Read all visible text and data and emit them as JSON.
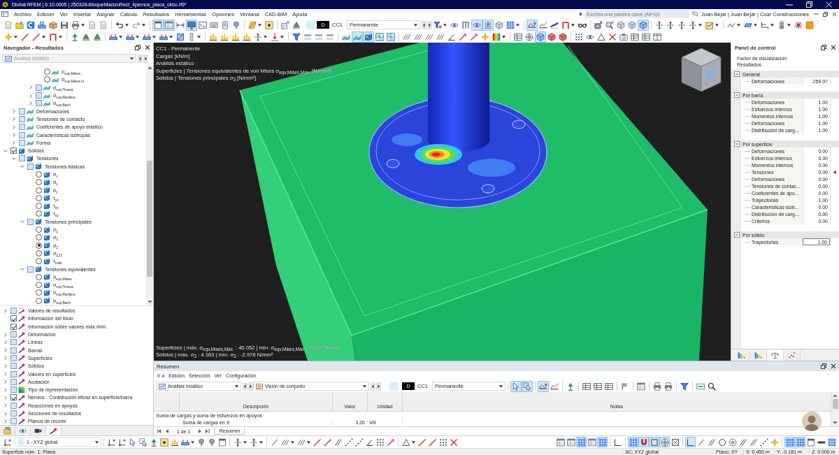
{
  "window": {
    "title": "Dlubal RFEM | 6.10.0005 | 250328-BloqueMacizoRect_4pernos_placa_circu.rf6*"
  },
  "menu": {
    "items": [
      "Archivo",
      "Edición",
      "Ver",
      "Insertar",
      "Asignar",
      "Cálculo",
      "Resultados",
      "Herramientas",
      "Opciones",
      "Ventana",
      "CAD-BIM",
      "Ayuda"
    ],
    "search": {
      "placeholder": "Escriba una palabra clave (Alt+Q)"
    },
    "user": "Juan Bejar | Juan Bejár | Coar Construcciones"
  },
  "toolbar_1": {
    "buttons": [
      {
        "pressed": false
      },
      {
        "pressed": false
      },
      {
        "pressed": false
      },
      {
        "pressed": false
      },
      {
        "pressed": false
      },
      {
        "pressed": false
      },
      {
        "pressed": false
      },
      {
        "pressed": false
      },
      {
        "pressed": false
      },
      {
        "pressed": false
      },
      {
        "pressed": false
      },
      {
        "pressed": true
      },
      {
        "pressed": true
      },
      {
        "pressed": false
      },
      {
        "pressed": true
      },
      {
        "pressed": false
      },
      {
        "pressed": false
      },
      {
        "pressed": false
      },
      {
        "pressed": false
      },
      {
        "pressed": false
      },
      {
        "pressed": false
      },
      {
        "pressed": false
      },
      {
        "pressed": false
      }
    ],
    "load_case": {
      "type": "D",
      "number": "CC1",
      "name": "Permanente"
    },
    "buttons_after": [
      {
        "pressed": false
      },
      {
        "pressed": false
      },
      {
        "pressed": false
      },
      {
        "pressed": true
      },
      {
        "pressed": true
      },
      {
        "pressed": false
      },
      {
        "pressed": false
      },
      {
        "pressed": true
      },
      {
        "pressed": false
      },
      {
        "pressed": false
      },
      {
        "pressed": false
      },
      {
        "pressed": false
      },
      {
        "pressed": false
      },
      {
        "pressed": false
      },
      {
        "pressed": false
      },
      {
        "pressed": false
      },
      {
        "pressed": true
      },
      {
        "pressed": false
      },
      {
        "pressed": false
      },
      {
        "pressed": false
      },
      {
        "pressed": false
      },
      {
        "pressed": false
      },
      {
        "pressed": false
      },
      {
        "pressed": false
      },
      {
        "pressed": false
      },
      {
        "pressed": false
      },
      {
        "pressed": false
      },
      {
        "pressed": false
      }
    ]
  },
  "toolbar_2": {
    "buttons": [
      {
        "pressed": false
      },
      {
        "pressed": false
      },
      {
        "pressed": false
      },
      {
        "pressed": false
      },
      {
        "pressed": false
      },
      {
        "pressed": false
      },
      {
        "pressed": false
      },
      {
        "pressed": false
      },
      {
        "pressed": false
      },
      {
        "pressed": false
      },
      {
        "pressed": false
      },
      {
        "pressed": false
      },
      {
        "pressed": false
      },
      {
        "pressed": false
      },
      {
        "pressed": false
      },
      {
        "pressed": false
      },
      {
        "pressed": false
      },
      {
        "pressed": false
      },
      {
        "pressed": false
      },
      {
        "pressed": false
      },
      {
        "pressed": false
      },
      {
        "pressed": false
      },
      {
        "pressed": false
      },
      {
        "pressed": false
      },
      {
        "pressed": true
      },
      {
        "pressed": true
      },
      {
        "pressed": false
      },
      {
        "pressed": false
      },
      {
        "pressed": false
      },
      {
        "pressed": false
      },
      {
        "pressed": false
      },
      {
        "pressed": false
      },
      {
        "pressed": false
      },
      {
        "pressed": false
      },
      {
        "pressed": false
      },
      {
        "pressed": false
      },
      {
        "pressed": false
      },
      {
        "pressed": false
      },
      {
        "pressed": false
      },
      {
        "pressed": true
      },
      {
        "pressed": false
      },
      {
        "pressed": false
      },
      {
        "pressed": false
      },
      {
        "pressed": false
      },
      {
        "pressed": false
      },
      {
        "pressed": false
      },
      {
        "pressed": false
      },
      {
        "pressed": false
      },
      {
        "pressed": false
      },
      {
        "pressed": false
      }
    ]
  },
  "navigator": {
    "title": "Navegador - Resultados",
    "analysis": {
      "value": "Análisis estático",
      "disabled": true
    },
    "results_tree": [
      {
        "children": [
          {
            "children": [
              {
                "children": [
                  {
                    "children": [
                      {
                        "label": "σ$_{eqv,Mises,-}$",
                        "kind": "radio",
                        "selected": false
                      },
                      {
                        "label": "σ$_{eqv,Mises,m}$",
                        "kind": "radio",
                        "selected": false
                      }
                    ]
                  },
                  {
                    "label": "σ$_{eqv,Tresca}$",
                    "kind": "check",
                    "checked": false,
                    "expanded": false
                  },
                  {
                    "label": "σ$_{eqv,Rankine}$",
                    "kind": "check",
                    "checked": false,
                    "expanded": false
                  },
                  {
                    "label": "σ$_{eqv,Bach}$",
                    "kind": "check",
                    "checked": false,
                    "expanded": false
                  }
                ]
              }
            ]
          },
          {
            "label": "Deformaciones",
            "kind": "check",
            "checked": false,
            "expanded": false
          },
          {
            "label": "Tensiones de contacto",
            "kind": "check",
            "checked": false,
            "expanded": false
          },
          {
            "label": "Coeficientes de apoyo elástico",
            "kind": "check",
            "checked": false,
            "expanded": false
          },
          {
            "label": "Características isótropas",
            "kind": "check",
            "checked": false,
            "expanded": false
          },
          {
            "label": "Forma",
            "kind": "check",
            "checked": false,
            "expanded": false
          }
        ]
      },
      {
        "label": "Sólidos",
        "kind": "check",
        "checked": true,
        "expanded": true,
        "children": [
          {
            "label": "Tensiones",
            "kind": "check",
            "checked": false,
            "expanded": true,
            "children": [
              {
                "label": "Tensiones básicas",
                "kind": "check",
                "checked": false,
                "expanded": true,
                "children": [
                  {
                    "label": "σ$_{x}$",
                    "kind": "radio",
                    "selected": false
                  },
                  {
                    "label": "σ$_{y}$",
                    "kind": "radio",
                    "selected": false
                  },
                  {
                    "label": "σ$_{z}$",
                    "kind": "radio",
                    "selected": false
                  },
                  {
                    "label": "τ$_{yz}$",
                    "kind": "radio",
                    "selected": false
                  },
                  {
                    "label": "τ$_{xz}$",
                    "kind": "radio",
                    "selected": false
                  },
                  {
                    "label": "τ$_{xy}$",
                    "kind": "radio",
                    "selected": false
                  }
                ]
              },
              {
                "label": "Tensiones principales",
                "kind": "check",
                "checked": false,
                "expanded": true,
                "children": [
                  {
                    "label": "σ$_{1}$",
                    "kind": "radio",
                    "selected": false
                  },
                  {
                    "label": "σ$_{2}$",
                    "kind": "radio",
                    "selected": false
                  },
                  {
                    "label": "σ$_{3}$",
                    "kind": "radio",
                    "selected": true
                  },
                  {
                    "label": "σ$_{123}$",
                    "kind": "radio",
                    "selected": false
                  },
                  {
                    "label": "τ$_{máx.}$",
                    "kind": "radio",
                    "selected": false
                  }
                ]
              },
              {
                "label": "Tensiones equivalentes",
                "kind": "check",
                "checked": false,
                "expanded": true,
                "children": [
                  {
                    "label": "σ$_{eqv,Mises}$",
                    "kind": "radio",
                    "selected": false
                  },
                  {
                    "label": "σ$_{eqv,Tresca}$",
                    "kind": "radio",
                    "selected": false
                  },
                  {
                    "label": "σ$_{eqv,Rankine}$",
                    "kind": "radio",
                    "selected": false
                  },
                  {
                    "label": "σ$_{eqv,Bach}$",
                    "kind": "radio",
                    "selected": false
                  }
                ]
              }
            ]
          }
        ]
      }
    ],
    "display_tree": [
      {
        "label": "Valores de resultados",
        "kind": "check",
        "checked": false,
        "expanded": false
      },
      {
        "label": "Información del título",
        "kind": "check",
        "checked": true
      },
      {
        "label": "Información sobre valores máx./mín.",
        "kind": "check",
        "checked": true
      },
      {
        "label": "Deformación",
        "kind": "check",
        "checked": false,
        "expanded": false
      },
      {
        "label": "Líneas",
        "kind": "check",
        "checked": false,
        "expanded": false
      },
      {
        "label": "Barras",
        "kind": "check",
        "checked": false,
        "expanded": false
      },
      {
        "label": "Superficies",
        "kind": "check",
        "checked": false,
        "expanded": false
      },
      {
        "label": "Sólidos",
        "kind": "check",
        "checked": false,
        "expanded": false
      },
      {
        "label": "Valores en superficies",
        "kind": "check",
        "checked": false,
        "expanded": false
      },
      {
        "label": "Acotación",
        "kind": "check",
        "checked": false,
        "expanded": false
      },
      {
        "label": "Tipo de representación",
        "kind": "check",
        "checked": false,
        "expanded": false
      },
      {
        "label": "Nervios - Contribución eficaz en superficie/barra",
        "kind": "check",
        "checked": true,
        "expanded": false
      },
      {
        "label": "Reacciones en apoyos",
        "kind": "check",
        "checked": false,
        "expanded": false
      },
      {
        "label": "Secciones de resultados",
        "kind": "check",
        "checked": false,
        "expanded": false
      },
      {
        "label": "Planos de recorte",
        "kind": "check",
        "checked": false,
        "expanded": false
      }
    ],
    "tabs": [
      {
        "selected": false
      },
      {
        "selected": false
      },
      {
        "selected": false
      },
      {
        "selected": true
      }
    ]
  },
  "viewport": {
    "title_lines": [
      "CC1 - Permanente",
      "Cargas [kN/m]",
      "Análisis estático",
      "Superficies | Tensiones equivalentes de von Mises σ$_{eqv,Mises,Máx.}$ [N/mm²]",
      "Sólidos | Tensiones principales σ$_{3}$ [N/mm²]"
    ],
    "summary_lines": [
      "Superficies | máx. σ$_{eqv,Mises,Máx.}$ : 45.052 | mín. σ$_{eqv,Mises,Máx.}$ : 0.207 N/mm²",
      "Sólidos | máx. σ$_{3}$ : 4.163 | mín. σ$_{3}$ : -2.978 N/mm²"
    ]
  },
  "control_panel": {
    "title": "Panel de control",
    "heading": [
      "Factor de visualización",
      "Resultados"
    ],
    "groups": [
      {
        "label": "General",
        "expanded": true,
        "rows": [
          {
            "label": "Deformaciones",
            "value": "259.97",
            "active": false,
            "editing": false
          }
        ]
      },
      {
        "label": "Por barra",
        "expanded": true,
        "rows": [
          {
            "label": "Deformaciones",
            "value": "1.00",
            "active": false,
            "editing": false
          },
          {
            "label": "Esfuerzos internos",
            "value": "1.00",
            "active": false,
            "editing": false
          },
          {
            "label": "Momentos internos",
            "value": "1.00",
            "active": false,
            "editing": false
          },
          {
            "label": "Deformaciones",
            "value": "1.00",
            "active": false,
            "editing": false
          },
          {
            "label": "Distribución de carg...",
            "value": "1.00",
            "active": false,
            "editing": false
          }
        ]
      },
      {
        "label": "Por superficie",
        "expanded": true,
        "rows": [
          {
            "label": "Deformaciones",
            "value": "0.00",
            "active": false,
            "editing": false
          },
          {
            "label": "Esfuerzos internos",
            "value": "0.00",
            "active": false,
            "editing": false
          },
          {
            "label": "Momentos internos",
            "value": "0.00",
            "active": false,
            "editing": false
          },
          {
            "label": "Tensiones",
            "value": "0.00",
            "active": true,
            "editing": false
          },
          {
            "label": "Deformaciones",
            "value": "0.00",
            "active": false,
            "editing": false
          },
          {
            "label": "Tensiones de contac...",
            "value": "0.00",
            "active": false,
            "editing": false
          },
          {
            "label": "Coeficientes de apo...",
            "value": "0.00",
            "active": false,
            "editing": false
          },
          {
            "label": "Trayectorias",
            "value": "1.00",
            "active": false,
            "editing": false
          },
          {
            "label": "Características isótr...",
            "value": "0.00",
            "active": false,
            "editing": false
          },
          {
            "label": "Distribución de carg...",
            "value": "0.00",
            "active": false,
            "editing": false
          },
          {
            "label": "Criterios",
            "value": "0.00",
            "active": false,
            "editing": false
          }
        ]
      },
      {
        "label": "Por sólido",
        "expanded": true,
        "rows": [
          {
            "label": "Trayectorias",
            "value": "1.00",
            "active": false,
            "editing": true
          }
        ]
      }
    ],
    "tabs": [
      {
        "selected": false
      },
      {
        "selected": false
      },
      {
        "selected": true
      },
      {
        "selected": false
      }
    ]
  },
  "summary": {
    "title": "Resumen",
    "menu": [
      "Ir a",
      "Edición",
      "Selección",
      "Ver",
      "Configuración"
    ],
    "analysis": "Análisis estático",
    "view": "Visión de conjunto",
    "load_case": {
      "type": "D",
      "number": "CC1",
      "name": "Permanente"
    },
    "buttons": [
      {
        "pressed": true
      },
      {
        "pressed": true
      },
      {
        "pressed": true
      },
      {
        "pressed": false
      },
      {
        "pressed": false
      },
      {
        "pressed": false
      },
      {
        "pressed": false
      },
      {
        "pressed": false
      },
      {
        "pressed": false
      },
      {
        "pressed": false
      },
      {
        "pressed": false
      },
      {
        "pressed": false
      },
      {
        "pressed": false
      },
      {
        "pressed": false
      },
      {
        "pressed": false
      }
    ],
    "table": {
      "columns": [
        "Descripción",
        "Valor",
        "Unidad",
        "Notas"
      ],
      "rows": [
        {
          "kind": "group",
          "cells": [
            "Suma de cargas y suma de esfuerzos en apoyos"
          ]
        },
        {
          "kind": "item",
          "cells": [
            "Suma de cargas en X",
            "3.20",
            "kN"
          ]
        }
      ]
    },
    "pager": {
      "page": "1 de 1"
    },
    "sheets": [
      {
        "label": "Resumen",
        "selected": true
      }
    ]
  },
  "bottom_toolbar": {
    "coordinate_system": "1 - XYZ global",
    "buttons": [
      {
        "pressed": false
      },
      {
        "pressed": false
      },
      {
        "pressed": false
      },
      {
        "pressed": false
      },
      {
        "pressed": false
      },
      {
        "pressed": false
      },
      {
        "pressed": false
      },
      {
        "pressed": false
      },
      {
        "pressed": false
      },
      {
        "pressed": false
      },
      {
        "pressed": false
      },
      {
        "pressed": false
      },
      {
        "pressed": false
      },
      {
        "pressed": false
      },
      {
        "pressed": false
      },
      {
        "pressed": false
      },
      {
        "pressed": false
      },
      {
        "pressed": false
      },
      {
        "pressed": false
      },
      {
        "pressed": false
      },
      {
        "pressed": false
      },
      {
        "pressed": false
      },
      {
        "pressed": false
      },
      {
        "pressed": false
      },
      {
        "pressed": false
      },
      {
        "pressed": false
      },
      {
        "pressed": false
      },
      {
        "pressed": false
      },
      {
        "pressed": false
      }
    ],
    "buttons_right": [
      {
        "pressed": false
      },
      {
        "pressed": false
      },
      {
        "pressed": true
      },
      {
        "pressed": false
      },
      {
        "pressed": true
      },
      {
        "pressed": false
      },
      {
        "pressed": true
      },
      {
        "pressed": true
      },
      {
        "pressed": true
      },
      {
        "pressed": true
      },
      {
        "pressed": false
      },
      {
        "pressed": true
      },
      {
        "pressed": false
      },
      {
        "pressed": false
      },
      {
        "pressed": false
      },
      {
        "pressed": false
      },
      {
        "pressed": false
      },
      {
        "pressed": false
      },
      {
        "pressed": false
      },
      {
        "pressed": false
      },
      {
        "pressed": true
      },
      {
        "pressed": true
      },
      {
        "pressed": false
      },
      {
        "pressed": false
      },
      {
        "pressed": false
      }
    ]
  },
  "status_bar": {
    "message": "Superficie núm. 1: Plana",
    "items": [
      "SC: XYZ global",
      "Plano: XY",
      "X: 0.450 m",
      "Y: -0.181 m",
      "Z: 0.000 m"
    ]
  }
}
